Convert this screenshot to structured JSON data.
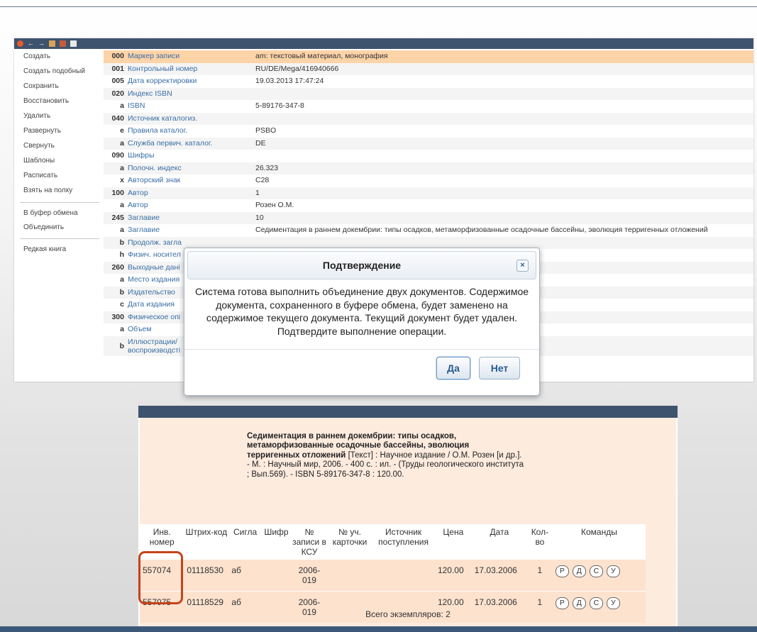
{
  "editor": {
    "sidebar": [
      "Создать",
      "Создать подобный",
      "Сохранить",
      "Восстановить",
      "Удалить",
      "Развернуть",
      "Свернуть",
      "Шаблоны",
      "Расписать",
      "Взять на полку",
      "В буфер обмена",
      "Объединить",
      "Редкая книга"
    ],
    "rows": [
      {
        "tag": "000",
        "name": "Маркер записи",
        "value": "am: текстовый материал, монография"
      },
      {
        "tag": "001",
        "name": "Контрольный номер",
        "value": "RU/DE/Mega/416940666"
      },
      {
        "tag": "005",
        "name": "Дата корректировки",
        "value": "19.03.2013 17:47:24"
      },
      {
        "tag": "020",
        "name": "Индекс ISBN",
        "value": ""
      },
      {
        "tag": "a",
        "name": "ISBN",
        "value": "5-89176-347-8"
      },
      {
        "tag": "040",
        "name": "Источник каталогиз.",
        "value": ""
      },
      {
        "tag": "e",
        "name": "Правила каталог.",
        "value": "PSBO"
      },
      {
        "tag": "a",
        "name": "Служба первич. каталог.",
        "value": "DE"
      },
      {
        "tag": "090",
        "name": "Шифры",
        "value": ""
      },
      {
        "tag": "a",
        "name": "Полочн. индекс",
        "value": "26.323"
      },
      {
        "tag": "x",
        "name": "Авторский знак",
        "value": "C28"
      },
      {
        "tag": "100",
        "name": "Автор",
        "value": "1"
      },
      {
        "tag": "a",
        "name": "Автор",
        "value": "Розен О.М."
      },
      {
        "tag": "245",
        "name": "Заглавие",
        "value": "10"
      },
      {
        "tag": "a",
        "name": "Заглавие",
        "value": "Седиментация в раннем докембрии: типы осадков, метаморфизованные осадочные бассейны, эволюция терригенных отложений"
      },
      {
        "tag": "b",
        "name": "Продолж. загла",
        "value": ""
      },
      {
        "tag": "h",
        "name": "Физич. носител",
        "value": ""
      },
      {
        "tag": "260",
        "name": "Выходные дані",
        "value": ""
      },
      {
        "tag": "a",
        "name": "Место издания",
        "value": ""
      },
      {
        "tag": "b",
        "name": "Издательство",
        "value": ""
      },
      {
        "tag": "c",
        "name": "Дата издания",
        "value": ""
      },
      {
        "tag": "300",
        "name": "Физическое опі",
        "value": ""
      },
      {
        "tag": "a",
        "name": "Объем",
        "value": ""
      },
      {
        "tag": "b",
        "name": "Иллюстрации/ воспроизводсті",
        "value": ""
      }
    ]
  },
  "dialog": {
    "title": "Подтверждение",
    "close": "×",
    "message": "Система готова выполнить объединение двух документов. Содержимое документа, сохраненного в буфере обмена, будет заменено на содержимое текущего документа. Текущий документ будет удален. Подтвердите выполнение операции.",
    "yes": "Да",
    "no": "Нет"
  },
  "record": {
    "title_bold": "Седиментация в раннем докембрии: типы осадков, метаморфизованные осадочные бассейны, эволюция терригенных отложений",
    "description": "[Текст] : Научное издание / О.М. Розен [и др.]. - М. : Научный мир, 2006. - 400 с. : ил. - (Труды геологического института ; Вып.569). - ISBN 5-89176-347-8 : 120.00.",
    "columns": [
      "Инв. номер",
      "Штрих-код",
      "Сигла",
      "Шифр",
      "№ записи в КСУ",
      "№ уч. карточки",
      "Источник поступления",
      "Цена",
      "Дата",
      "Кол-во",
      "Команды"
    ],
    "rows": [
      {
        "inv": "557074",
        "barcode": "01118530",
        "sigla": "аб",
        "shifr": "",
        "ksu": "2006-019",
        "card": "",
        "source": "",
        "price": "120.00",
        "date": "17.03.2006",
        "qty": "1"
      },
      {
        "inv": "557075",
        "barcode": "01118529",
        "sigla": "аб",
        "shifr": "",
        "ksu": "2006-019",
        "card": "",
        "source": "",
        "price": "120.00",
        "date": "17.03.2006",
        "qty": "1"
      }
    ],
    "commands": [
      "Р",
      "Д",
      "С",
      "У"
    ],
    "total": "Всего экземпляров: 2"
  }
}
